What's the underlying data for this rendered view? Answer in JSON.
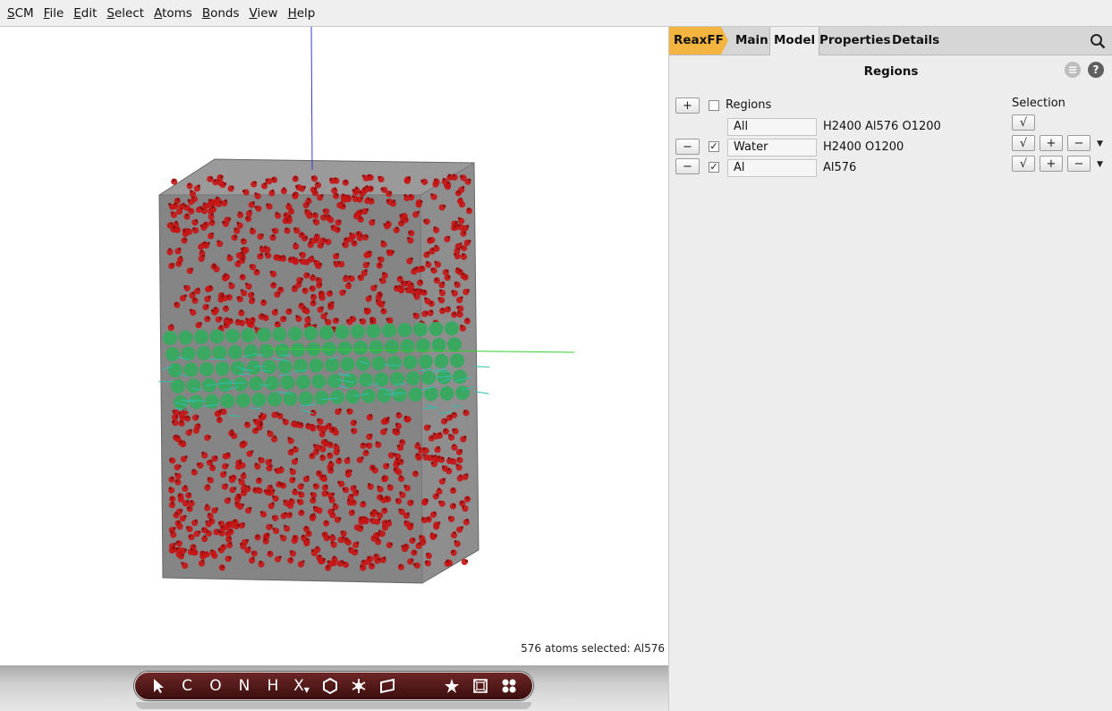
{
  "menubar": {
    "items": [
      {
        "mnemonic": "S",
        "rest": "CM"
      },
      {
        "mnemonic": "F",
        "rest": "ile"
      },
      {
        "mnemonic": "E",
        "rest": "dit"
      },
      {
        "mnemonic": "S",
        "rest": "elect"
      },
      {
        "mnemonic": "A",
        "rest": "toms"
      },
      {
        "mnemonic": "B",
        "rest": "onds"
      },
      {
        "mnemonic": "V",
        "rest": "iew"
      },
      {
        "mnemonic": "H",
        "rest": "elp"
      }
    ]
  },
  "viewport": {
    "status": "576 atoms selected: Al576",
    "colors": {
      "cell_box": "#8a8a8a",
      "water_oxygen": "#c81414",
      "aluminum": "#3aa860",
      "axis_x": "#2fcf2f",
      "axis_z": "#3a3acf"
    }
  },
  "toolbar": {
    "tools": [
      {
        "name": "pointer-tool",
        "label": ""
      },
      {
        "name": "carbon-tool",
        "label": "C"
      },
      {
        "name": "oxygen-tool",
        "label": "O"
      },
      {
        "name": "nitrogen-tool",
        "label": "N"
      },
      {
        "name": "hydrogen-tool",
        "label": "H"
      },
      {
        "name": "element-x-tool",
        "label": "X"
      }
    ],
    "icons": [
      "hexagon-icon",
      "snowflake-icon",
      "plane-icon",
      "star-icon",
      "cell-icon",
      "molecules-icon"
    ]
  },
  "panel": {
    "tabs": {
      "reaxff": "ReaxFF",
      "main": "Main",
      "model": "Model",
      "properties": "Properties",
      "details": "Details"
    },
    "active_tab": "Model",
    "accent_color": "#f3b53f",
    "title": "Regions",
    "header_label": "Regions",
    "selection_label": "Selection",
    "regions": [
      {
        "name": "All",
        "composition": "H2400 Al576 O1200",
        "checked": null
      },
      {
        "name": "Water",
        "composition": "H2400 O1200",
        "checked": true
      },
      {
        "name": "Al",
        "composition": "Al576",
        "checked": true
      }
    ],
    "buttons": {
      "add": "+",
      "remove": "−",
      "select": "√",
      "plus": "+",
      "minus": "−",
      "check_mark": "✓"
    }
  }
}
